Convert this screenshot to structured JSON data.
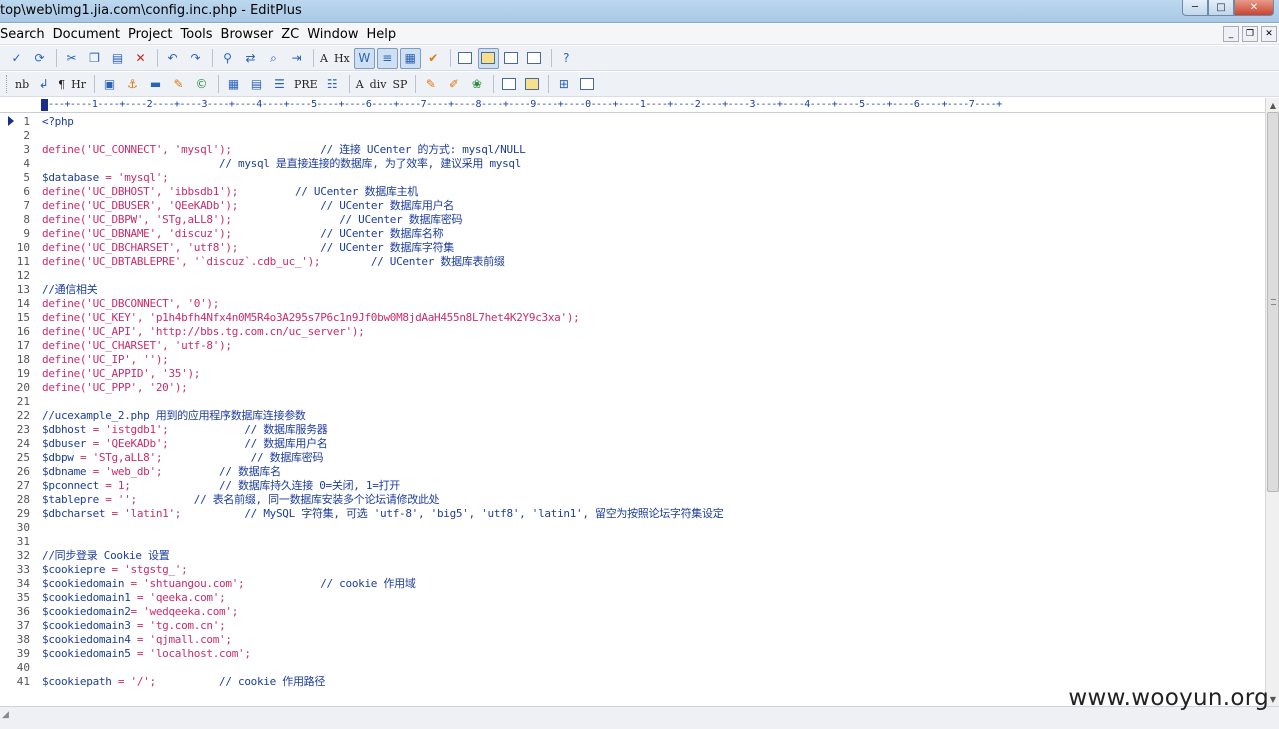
{
  "window": {
    "title": "top\\web\\img1.jia.com\\config.inc.php - EditPlus",
    "min_label": "─",
    "max_label": "□",
    "close_label": "✕"
  },
  "menu": [
    "Search",
    "Document",
    "Project",
    "Tools",
    "Browser",
    "ZC",
    "Window",
    "Help"
  ],
  "mdi_buttons": [
    "_",
    "❐",
    "✕"
  ],
  "toolbar2_text": {
    "nb": "nb",
    "p": "¶",
    "hr": "Hr",
    "pre": "PRE",
    "div": "div",
    "sp": "SP",
    "hx": "Hx",
    "a": "A"
  },
  "ruler": "---+----1----+----2----+----3----+----4----+----5----+----6----+----7----+----8----+----9----+----0----+----1----+----2----+----3----+----4----+----5----+----6----+----7----+",
  "editor": {
    "lines": [
      {
        "n": "1",
        "segs": [
          {
            "t": "<?php",
            "c": "c-var"
          }
        ]
      },
      {
        "n": "2",
        "segs": []
      },
      {
        "n": "3",
        "segs": [
          {
            "t": "define(",
            "c": "c-kw"
          },
          {
            "t": "'UC_CONNECT'",
            "c": "c-str"
          },
          {
            "t": ", ",
            "c": "c-kw"
          },
          {
            "t": "'mysql'",
            "c": "c-str"
          },
          {
            "t": ");",
            "c": "c-kw"
          },
          {
            "t": "              // 连接 UCenter 的方式: mysql/NULL",
            "c": "c-cm"
          }
        ]
      },
      {
        "n": "4",
        "segs": [
          {
            "t": "                            // mysql 是直接连接的数据库, 为了效率, 建议采用 mysql",
            "c": "c-cm"
          }
        ]
      },
      {
        "n": "5",
        "segs": [
          {
            "t": "$database",
            "c": "c-var"
          },
          {
            "t": " = ",
            "c": "c-kw"
          },
          {
            "t": "'mysql'",
            "c": "c-str"
          },
          {
            "t": ";",
            "c": "c-kw"
          }
        ]
      },
      {
        "n": "6",
        "segs": [
          {
            "t": "define(",
            "c": "c-kw"
          },
          {
            "t": "'UC_DBHOST'",
            "c": "c-str"
          },
          {
            "t": ", ",
            "c": "c-kw"
          },
          {
            "t": "'ibbsdb1'",
            "c": "c-str"
          },
          {
            "t": ");",
            "c": "c-kw"
          },
          {
            "t": "         // UCenter 数据库主机",
            "c": "c-cm"
          }
        ]
      },
      {
        "n": "7",
        "segs": [
          {
            "t": "define(",
            "c": "c-kw"
          },
          {
            "t": "'UC_DBUSER'",
            "c": "c-str"
          },
          {
            "t": ", ",
            "c": "c-kw"
          },
          {
            "t": "'QEeKADb'",
            "c": "c-str"
          },
          {
            "t": ");",
            "c": "c-kw"
          },
          {
            "t": "             // UCenter 数据库用户名",
            "c": "c-cm"
          }
        ]
      },
      {
        "n": "8",
        "segs": [
          {
            "t": "define(",
            "c": "c-kw"
          },
          {
            "t": "'UC_DBPW'",
            "c": "c-str"
          },
          {
            "t": ", ",
            "c": "c-kw"
          },
          {
            "t": "'STg,aLL8'",
            "c": "c-str"
          },
          {
            "t": ");",
            "c": "c-kw"
          },
          {
            "t": "                 // UCenter 数据库密码",
            "c": "c-cm"
          }
        ]
      },
      {
        "n": "9",
        "segs": [
          {
            "t": "define(",
            "c": "c-kw"
          },
          {
            "t": "'UC_DBNAME'",
            "c": "c-str"
          },
          {
            "t": ", ",
            "c": "c-kw"
          },
          {
            "t": "'discuz'",
            "c": "c-str"
          },
          {
            "t": ");",
            "c": "c-kw"
          },
          {
            "t": "              // UCenter 数据库名称",
            "c": "c-cm"
          }
        ]
      },
      {
        "n": "10",
        "segs": [
          {
            "t": "define(",
            "c": "c-kw"
          },
          {
            "t": "'UC_DBCHARSET'",
            "c": "c-str"
          },
          {
            "t": ", ",
            "c": "c-kw"
          },
          {
            "t": "'utf8'",
            "c": "c-str"
          },
          {
            "t": ");",
            "c": "c-kw"
          },
          {
            "t": "             // UCenter 数据库字符集",
            "c": "c-cm"
          }
        ]
      },
      {
        "n": "11",
        "segs": [
          {
            "t": "define(",
            "c": "c-kw"
          },
          {
            "t": "'UC_DBTABLEPRE'",
            "c": "c-str"
          },
          {
            "t": ", ",
            "c": "c-kw"
          },
          {
            "t": "'`discuz`.cdb_uc_'",
            "c": "c-str"
          },
          {
            "t": ");",
            "c": "c-kw"
          },
          {
            "t": "        // UCenter 数据库表前缀",
            "c": "c-cm"
          }
        ]
      },
      {
        "n": "12",
        "segs": []
      },
      {
        "n": "13",
        "segs": [
          {
            "t": "//通信相关",
            "c": "c-cm"
          }
        ]
      },
      {
        "n": "14",
        "segs": [
          {
            "t": "define(",
            "c": "c-kw"
          },
          {
            "t": "'UC_DBCONNECT'",
            "c": "c-str"
          },
          {
            "t": ", ",
            "c": "c-kw"
          },
          {
            "t": "'0'",
            "c": "c-str"
          },
          {
            "t": ");",
            "c": "c-kw"
          }
        ]
      },
      {
        "n": "15",
        "segs": [
          {
            "t": "define(",
            "c": "c-kw"
          },
          {
            "t": "'UC_KEY'",
            "c": "c-str"
          },
          {
            "t": ", ",
            "c": "c-kw"
          },
          {
            "t": "'p1h4bfh4Nfx4n0M5R4o3A295s7P6c1n9Jf0bw0M8jdAaH455n8L7het4K2Y9c3xa'",
            "c": "c-str"
          },
          {
            "t": ");",
            "c": "c-kw"
          }
        ]
      },
      {
        "n": "16",
        "segs": [
          {
            "t": "define(",
            "c": "c-kw"
          },
          {
            "t": "'UC_API'",
            "c": "c-str"
          },
          {
            "t": ", ",
            "c": "c-kw"
          },
          {
            "t": "'http://bbs.tg.com.cn/uc_server'",
            "c": "c-str"
          },
          {
            "t": ");",
            "c": "c-kw"
          }
        ]
      },
      {
        "n": "17",
        "segs": [
          {
            "t": "define(",
            "c": "c-kw"
          },
          {
            "t": "'UC_CHARSET'",
            "c": "c-str"
          },
          {
            "t": ", ",
            "c": "c-kw"
          },
          {
            "t": "'utf-8'",
            "c": "c-str"
          },
          {
            "t": ");",
            "c": "c-kw"
          }
        ]
      },
      {
        "n": "18",
        "segs": [
          {
            "t": "define(",
            "c": "c-kw"
          },
          {
            "t": "'UC_IP'",
            "c": "c-str"
          },
          {
            "t": ", ",
            "c": "c-kw"
          },
          {
            "t": "''",
            "c": "c-str"
          },
          {
            "t": ");",
            "c": "c-kw"
          }
        ]
      },
      {
        "n": "19",
        "segs": [
          {
            "t": "define(",
            "c": "c-kw"
          },
          {
            "t": "'UC_APPID'",
            "c": "c-str"
          },
          {
            "t": ", ",
            "c": "c-kw"
          },
          {
            "t": "'35'",
            "c": "c-str"
          },
          {
            "t": ");",
            "c": "c-kw"
          }
        ]
      },
      {
        "n": "20",
        "segs": [
          {
            "t": "define(",
            "c": "c-kw"
          },
          {
            "t": "'UC_PPP'",
            "c": "c-str"
          },
          {
            "t": ", ",
            "c": "c-kw"
          },
          {
            "t": "'20'",
            "c": "c-str"
          },
          {
            "t": ");",
            "c": "c-kw"
          }
        ]
      },
      {
        "n": "21",
        "segs": []
      },
      {
        "n": "22",
        "segs": [
          {
            "t": "//ucexample_2.php 用到的应用程序数据库连接参数",
            "c": "c-cm"
          }
        ]
      },
      {
        "n": "23",
        "segs": [
          {
            "t": "$dbhost",
            "c": "c-var"
          },
          {
            "t": " = ",
            "c": "c-kw"
          },
          {
            "t": "'istgdb1'",
            "c": "c-str"
          },
          {
            "t": ";",
            "c": "c-kw"
          },
          {
            "t": "            // 数据库服务器",
            "c": "c-cm"
          }
        ]
      },
      {
        "n": "24",
        "segs": [
          {
            "t": "$dbuser",
            "c": "c-var"
          },
          {
            "t": " = ",
            "c": "c-kw"
          },
          {
            "t": "'QEeKADb'",
            "c": "c-str"
          },
          {
            "t": ";",
            "c": "c-kw"
          },
          {
            "t": "            // 数据库用户名",
            "c": "c-cm"
          }
        ]
      },
      {
        "n": "25",
        "segs": [
          {
            "t": "$dbpw",
            "c": "c-var"
          },
          {
            "t": " = ",
            "c": "c-kw"
          },
          {
            "t": "'STg,aLL8'",
            "c": "c-str"
          },
          {
            "t": ";",
            "c": "c-kw"
          },
          {
            "t": "              // 数据库密码",
            "c": "c-cm"
          }
        ]
      },
      {
        "n": "26",
        "segs": [
          {
            "t": "$dbname",
            "c": "c-var"
          },
          {
            "t": " = ",
            "c": "c-kw"
          },
          {
            "t": "'web_db'",
            "c": "c-str"
          },
          {
            "t": ";",
            "c": "c-kw"
          },
          {
            "t": "         // 数据库名",
            "c": "c-cm"
          }
        ]
      },
      {
        "n": "27",
        "segs": [
          {
            "t": "$pconnect",
            "c": "c-var"
          },
          {
            "t": " = ",
            "c": "c-kw"
          },
          {
            "t": "1",
            "c": "c-str"
          },
          {
            "t": ";",
            "c": "c-kw"
          },
          {
            "t": "              // 数据库持久连接 0=关闭, 1=打开",
            "c": "c-cm"
          }
        ]
      },
      {
        "n": "28",
        "segs": [
          {
            "t": "$tablepre",
            "c": "c-var"
          },
          {
            "t": " = ",
            "c": "c-kw"
          },
          {
            "t": "''",
            "c": "c-str"
          },
          {
            "t": ";",
            "c": "c-kw"
          },
          {
            "t": "         // 表名前缀, 同一数据库安装多个论坛请修改此处",
            "c": "c-cm"
          }
        ]
      },
      {
        "n": "29",
        "segs": [
          {
            "t": "$dbcharset",
            "c": "c-var"
          },
          {
            "t": " = ",
            "c": "c-kw"
          },
          {
            "t": "'latin1'",
            "c": "c-str"
          },
          {
            "t": ";",
            "c": "c-kw"
          },
          {
            "t": "          // MySQL 字符集, 可选 'utf-8', 'big5', 'utf8', 'latin1', 留空为按照论坛字符集设定",
            "c": "c-cm"
          }
        ]
      },
      {
        "n": "30",
        "segs": []
      },
      {
        "n": "31",
        "segs": []
      },
      {
        "n": "32",
        "segs": [
          {
            "t": "//同步登录 Cookie 设置",
            "c": "c-cm"
          }
        ]
      },
      {
        "n": "33",
        "segs": [
          {
            "t": "$cookiepre",
            "c": "c-var"
          },
          {
            "t": " = ",
            "c": "c-kw"
          },
          {
            "t": "'stgstg_'",
            "c": "c-str"
          },
          {
            "t": ";",
            "c": "c-kw"
          }
        ]
      },
      {
        "n": "34",
        "segs": [
          {
            "t": "$cookiedomain",
            "c": "c-var"
          },
          {
            "t": " = ",
            "c": "c-kw"
          },
          {
            "t": "'shtuangou.com'",
            "c": "c-str"
          },
          {
            "t": ";",
            "c": "c-kw"
          },
          {
            "t": "            // cookie 作用域",
            "c": "c-cm"
          }
        ]
      },
      {
        "n": "35",
        "segs": [
          {
            "t": "$cookiedomain1",
            "c": "c-var"
          },
          {
            "t": " = ",
            "c": "c-kw"
          },
          {
            "t": "'qeeka.com'",
            "c": "c-str"
          },
          {
            "t": ";",
            "c": "c-kw"
          }
        ]
      },
      {
        "n": "36",
        "segs": [
          {
            "t": "$cookiedomain2",
            "c": "c-var"
          },
          {
            "t": "= ",
            "c": "c-kw"
          },
          {
            "t": "'wedqeeka.com'",
            "c": "c-str"
          },
          {
            "t": ";",
            "c": "c-kw"
          }
        ]
      },
      {
        "n": "37",
        "segs": [
          {
            "t": "$cookiedomain3",
            "c": "c-var"
          },
          {
            "t": " = ",
            "c": "c-kw"
          },
          {
            "t": "'tg.com.cn'",
            "c": "c-str"
          },
          {
            "t": ";",
            "c": "c-kw"
          }
        ]
      },
      {
        "n": "38",
        "segs": [
          {
            "t": "$cookiedomain4",
            "c": "c-var"
          },
          {
            "t": " = ",
            "c": "c-kw"
          },
          {
            "t": "'qjmall.com'",
            "c": "c-str"
          },
          {
            "t": ";",
            "c": "c-kw"
          }
        ]
      },
      {
        "n": "39",
        "segs": [
          {
            "t": "$cookiedomain5",
            "c": "c-var"
          },
          {
            "t": " = ",
            "c": "c-kw"
          },
          {
            "t": "'localhost.com'",
            "c": "c-str"
          },
          {
            "t": ";",
            "c": "c-kw"
          }
        ]
      },
      {
        "n": "40",
        "segs": []
      },
      {
        "n": "41",
        "segs": [
          {
            "t": "$cookiepath",
            "c": "c-var"
          },
          {
            "t": " = ",
            "c": "c-kw"
          },
          {
            "t": "'/'",
            "c": "c-str"
          },
          {
            "t": ";",
            "c": "c-kw"
          },
          {
            "t": "          // cookie 作用路径",
            "c": "c-cm"
          }
        ]
      }
    ]
  },
  "colors": {
    "keyword": "#cc2b6b",
    "comment": "#1d3d9c",
    "line_number": "#555555"
  },
  "watermark": "www.wooyun.org"
}
